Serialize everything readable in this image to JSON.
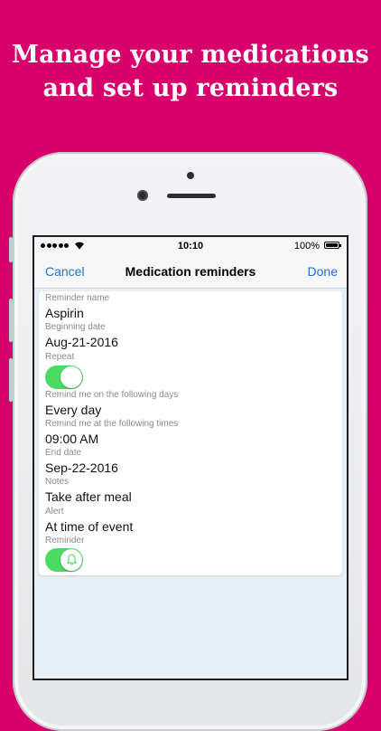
{
  "promo": {
    "line1": "Manage your medications",
    "line2": "and set up reminders"
  },
  "status_bar": {
    "time": "10:10",
    "battery": "100%"
  },
  "nav": {
    "cancel": "Cancel",
    "title": "Medication reminders",
    "done": "Done"
  },
  "form": {
    "reminder_name": {
      "label": "Reminder name",
      "value": "Aspirin"
    },
    "beginning_date": {
      "label": "Beginning date",
      "value": "Aug-21-2016"
    },
    "repeat": {
      "label": "Repeat",
      "on": true
    },
    "days": {
      "label": "Remind me on the following days",
      "value": "Every day"
    },
    "times": {
      "label": "Remind me at the following times",
      "value": "09:00 AM"
    },
    "end_date": {
      "label": "End date",
      "value": "Sep-22-2016"
    },
    "notes": {
      "label": "Notes",
      "value": "Take after meal"
    },
    "alert": {
      "label": "Alert",
      "value": "At time of event"
    },
    "reminder": {
      "label": "Reminder",
      "on": true
    }
  },
  "colors": {
    "background": "#d8006b",
    "accent": "#1f6fd6",
    "toggle_on": "#4cd964"
  }
}
